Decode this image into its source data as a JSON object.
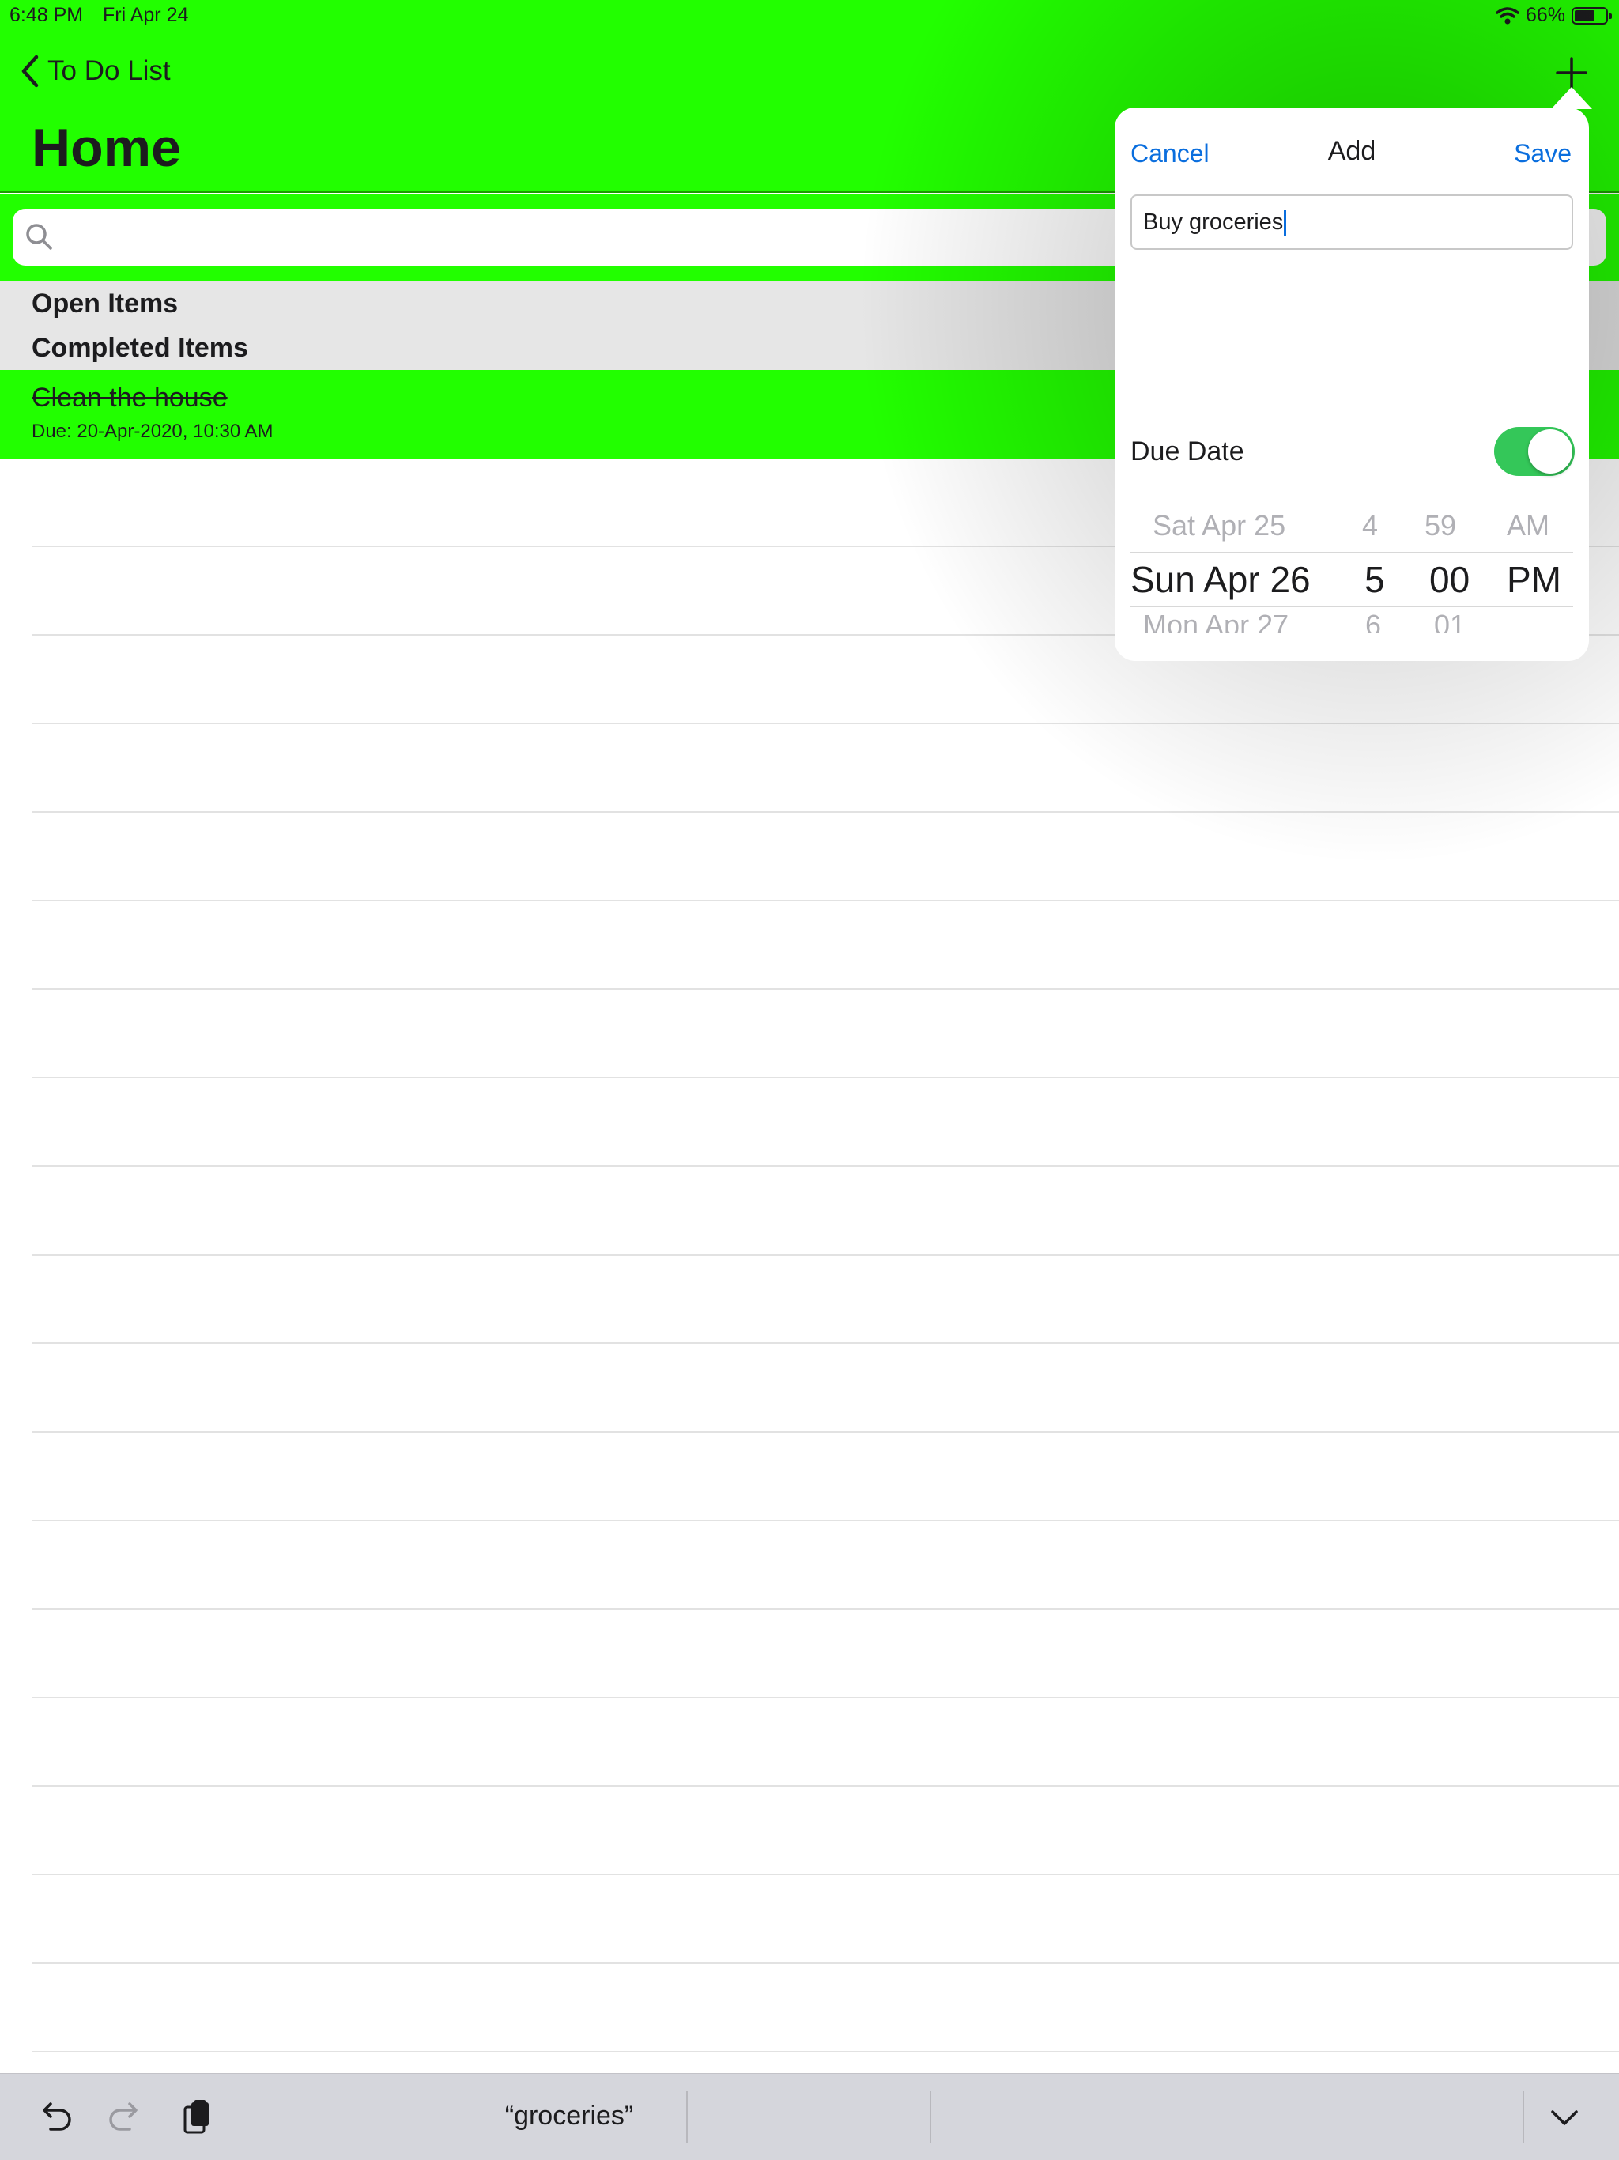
{
  "status_bar": {
    "time": "6:48 PM",
    "date": "Fri Apr 24",
    "battery": "66%",
    "battery_level": 0.66
  },
  "nav": {
    "back_label": "To Do List",
    "title": "Home"
  },
  "search": {
    "placeholder": ""
  },
  "sections": {
    "open": "Open Items",
    "completed": "Completed Items"
  },
  "completed_items": [
    {
      "title": "Clean the house",
      "due": "Due: 20-Apr-2020, 10:30 AM"
    }
  ],
  "popover": {
    "cancel": "Cancel",
    "title": "Add",
    "save": "Save",
    "item_text": "Buy groceries",
    "due_label": "Due Date",
    "due_enabled": true,
    "picker": {
      "prev": {
        "date": "Sat Apr 25",
        "hour": "4",
        "minute": "59",
        "ampm": "AM"
      },
      "selected": {
        "date": "Sun Apr 26",
        "hour": "5",
        "minute": "00",
        "ampm": "PM"
      },
      "next": {
        "date": "Mon Apr 27",
        "hour": "6",
        "minute": "01",
        "ampm": ""
      }
    }
  },
  "keyboard_bar": {
    "suggestion": "“groceries”"
  },
  "colors": {
    "accent_green": "#22ff00",
    "link_blue": "#0a6ede",
    "toggle_on": "#34c759"
  },
  "icons": [
    "chevron-left-icon",
    "plus-icon",
    "search-icon",
    "wifi-icon",
    "battery-icon",
    "undo-icon",
    "redo-icon",
    "paste-icon",
    "chevron-down-icon"
  ]
}
